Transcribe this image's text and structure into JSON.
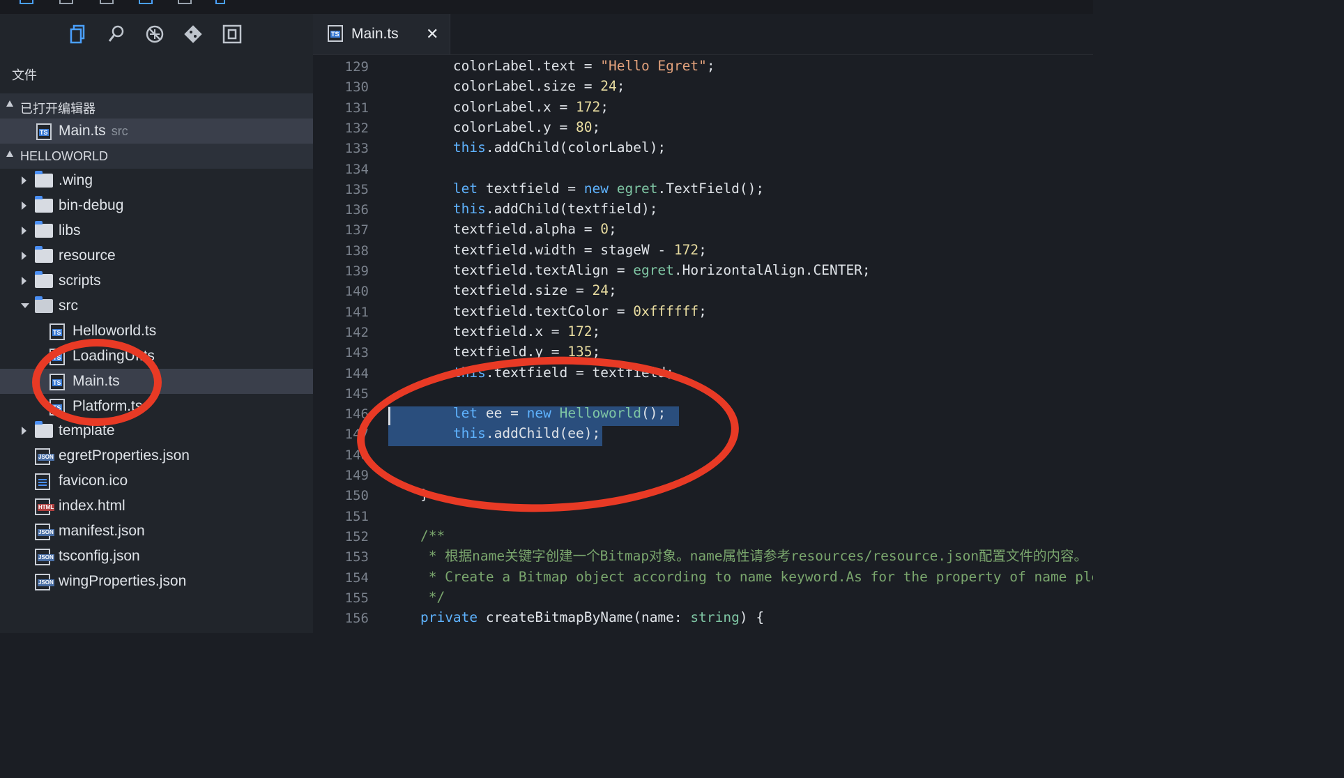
{
  "toolbar": {
    "icons": [
      "new-file-icon",
      "save-icon",
      "branch-icon",
      "layout-icon",
      "debug-icon",
      "run-icon"
    ]
  },
  "activity_bar": {
    "items": [
      "files-icon",
      "search-icon",
      "debug-icon",
      "git-icon",
      "extensions-icon"
    ],
    "active": "files-icon",
    "accent_color": "#4aa0ff"
  },
  "explorer": {
    "title": "文件",
    "open_editors": {
      "label": "已打开编辑器",
      "items": [
        {
          "name": "Main.ts",
          "folder": "src",
          "icon": "TS"
        }
      ]
    },
    "project": {
      "label": "HELLOWORLD",
      "items": [
        {
          "name": ".wing",
          "type": "folder"
        },
        {
          "name": "bin-debug",
          "type": "folder"
        },
        {
          "name": "libs",
          "type": "folder"
        },
        {
          "name": "resource",
          "type": "folder"
        },
        {
          "name": "scripts",
          "type": "folder"
        },
        {
          "name": "src",
          "type": "folder"
        },
        {
          "name": "Helloworld.ts",
          "type": "file",
          "icon": "TS"
        },
        {
          "name": "LoadingUI.ts",
          "type": "file",
          "icon": "TS"
        },
        {
          "name": "Main.ts",
          "type": "file",
          "icon": "TS"
        },
        {
          "name": "Platform.ts",
          "type": "file",
          "icon": "TS"
        },
        {
          "name": "template",
          "type": "folder"
        },
        {
          "name": "egretProperties.json",
          "type": "file",
          "icon": "JSON"
        },
        {
          "name": "favicon.ico",
          "type": "file",
          "icon": "ico"
        },
        {
          "name": "index.html",
          "type": "file",
          "icon": "HTML"
        },
        {
          "name": "manifest.json",
          "type": "file",
          "icon": "JSON"
        },
        {
          "name": "tsconfig.json",
          "type": "file",
          "icon": "JSON"
        },
        {
          "name": "wingProperties.json",
          "type": "file",
          "icon": "JSON"
        }
      ]
    }
  },
  "editor": {
    "tab": {
      "label": "Main.ts",
      "close": "✕",
      "icon": "TS"
    },
    "line_numbers": [
      "129",
      "130",
      "131",
      "132",
      "133",
      "134",
      "135",
      "136",
      "137",
      "138",
      "139",
      "140",
      "141",
      "142",
      "143",
      "144",
      "145",
      "146",
      "147",
      "148",
      "149",
      "150",
      "151",
      "152",
      "153",
      "154",
      "155",
      "156"
    ],
    "lines": [
      "        colorLabel.text = \"Hello Egret\";",
      "        colorLabel.size = 24;",
      "        colorLabel.x = 172;",
      "        colorLabel.y = 80;",
      "        this.addChild(colorLabel);",
      "",
      "        let textfield = new egret.TextField();",
      "        this.addChild(textfield);",
      "        textfield.alpha = 0;",
      "        textfield.width = stageW - 172;",
      "        textfield.textAlign = egret.HorizontalAlign.CENTER;",
      "        textfield.size = 24;",
      "        textfield.textColor = 0xffffff;",
      "        textfield.x = 172;",
      "        textfield.y = 135;",
      "        this.textfield = textfield;",
      "",
      "        let ee = new Helloworld();",
      "        this.addChild(ee);",
      "",
      "",
      "    }",
      "",
      "    /**",
      "     * 根据name关键字创建一个Bitmap对象。name属性请参考resources/resource.json配置文件的内容。",
      "     * Create a Bitmap object according to name keyword.As for the property of name please refer to the configuration file of resources/resource.json.",
      "     */",
      "    private createBitmapByName(name: string) {"
    ],
    "selected_lines": [
      "147",
      "148"
    ]
  },
  "annotations": {
    "ring_color": "#e83a25"
  }
}
